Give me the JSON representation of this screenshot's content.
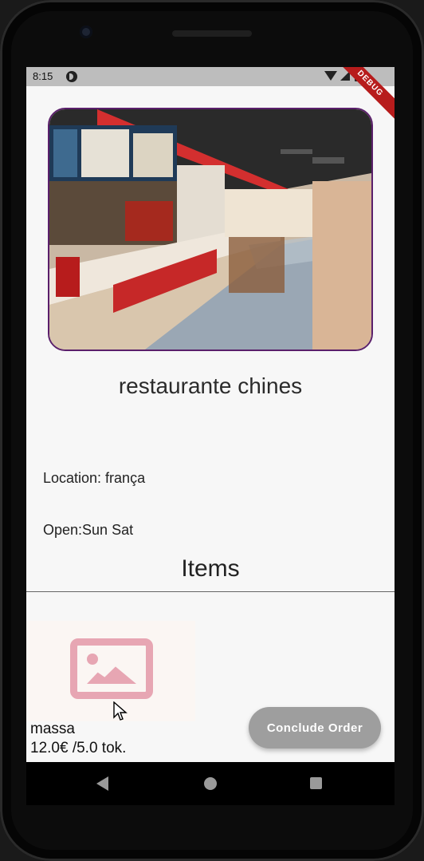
{
  "status_bar": {
    "time": "8:15",
    "debug_label": "DEBUG"
  },
  "restaurant": {
    "name": "restaurante chines",
    "location": "Location: frança",
    "open": "Open:Sun Sat",
    "hero_image": "restaurant-interior-photo"
  },
  "items_section": {
    "title": "Items"
  },
  "items": [
    {
      "name": "massa",
      "price": "12.0€ /5.0 tok.",
      "image": "image-placeholder-icon"
    }
  ],
  "actions": {
    "conclude_label": "Conclude Order"
  },
  "colors": {
    "accent_placeholder": "#e7a6b3",
    "button_gray": "#9e9e9e",
    "hero_border": "#5a1f6b",
    "debug_red": "#b71c1c"
  }
}
